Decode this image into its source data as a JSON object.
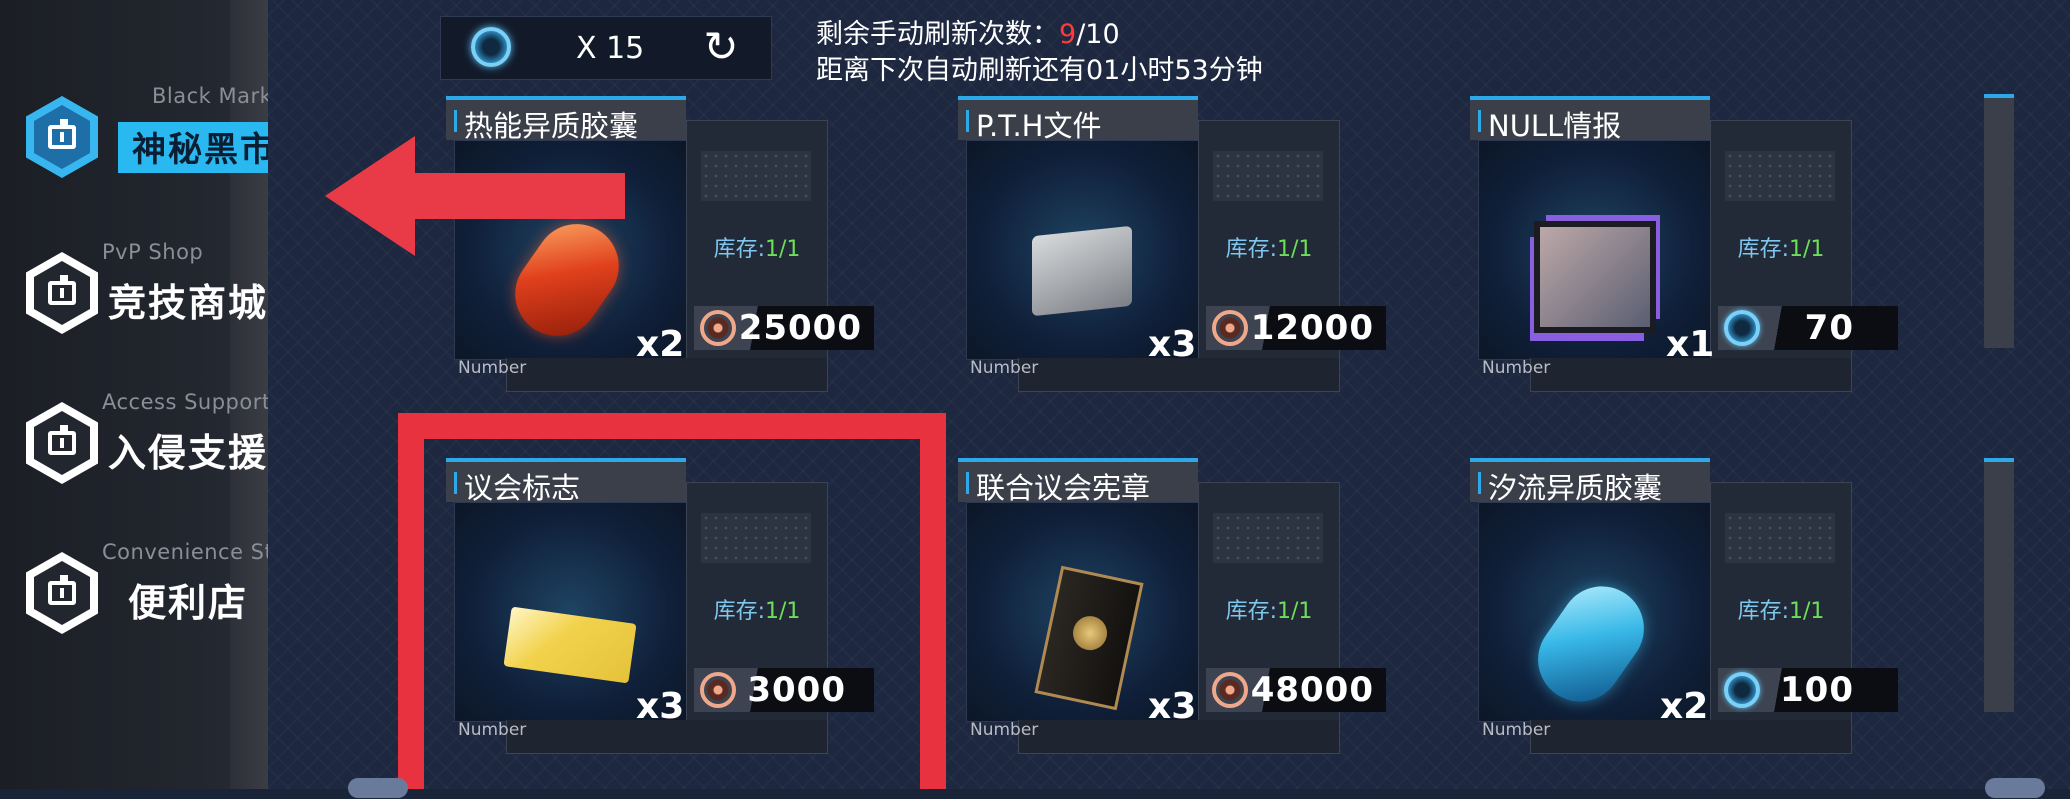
{
  "sidebar": {
    "items": [
      {
        "en": "Black Market",
        "cn": "神秘黑市",
        "active": true
      },
      {
        "en": "PvP Shop",
        "cn": "竞技商城",
        "active": false
      },
      {
        "en": "Access Support",
        "cn": "入侵支援",
        "active": false
      },
      {
        "en": "Convenience Store",
        "cn": "便利店",
        "active": false
      }
    ]
  },
  "topbar": {
    "currency_count": "X 15",
    "refresh_icon": "refresh-icon"
  },
  "refresh_info": {
    "remaining_label": "剩余手动刷新次数：",
    "remaining_used": "9",
    "remaining_total": "/10",
    "next_auto": "距离下次自动刷新还有01小时53分钟"
  },
  "cards": [
    {
      "name": "热能异质胶囊",
      "stock_label": "库存:",
      "stock": "1/1",
      "qty": "x2",
      "price": "25000",
      "currency": "coin",
      "number_label": "Number"
    },
    {
      "name": "P.T.H文件",
      "stock_label": "库存:",
      "stock": "1/1",
      "qty": "x3",
      "price": "12000",
      "currency": "coin",
      "number_label": "Number"
    },
    {
      "name": "NULL情报",
      "stock_label": "库存:",
      "stock": "1/1",
      "qty": "x1",
      "price": "70",
      "currency": "gem",
      "number_label": "Number"
    },
    {
      "name": "议会标志",
      "stock_label": "库存:",
      "stock": "1/1",
      "qty": "x3",
      "price": "3000",
      "currency": "coin",
      "number_label": "Number"
    },
    {
      "name": "联合议会宪章",
      "stock_label": "库存:",
      "stock": "1/1",
      "qty": "x3",
      "price": "48000",
      "currency": "coin",
      "number_label": "Number"
    },
    {
      "name": "汐流异质胶囊",
      "stock_label": "库存:",
      "stock": "1/1",
      "qty": "x2",
      "price": "100",
      "currency": "gem",
      "number_label": "Number"
    }
  ],
  "colors": {
    "accent": "#2ab8f0",
    "annotation_red": "#e8323f",
    "stock_green": "#6dde5a"
  }
}
